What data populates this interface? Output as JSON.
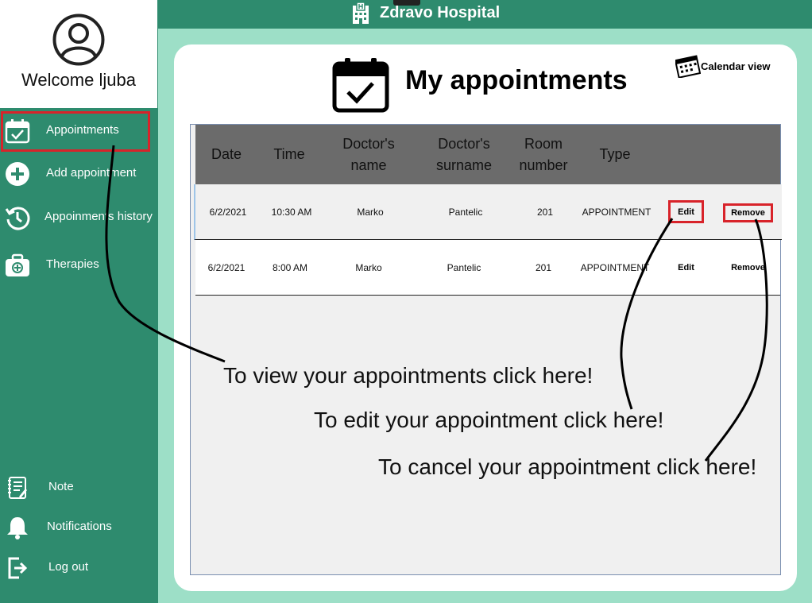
{
  "app": {
    "title": "Zdravo Hospital"
  },
  "profile": {
    "welcome": "Welcome ljuba"
  },
  "sidebar": {
    "items": [
      {
        "label": "Appointments",
        "icon": "calendar-check-icon",
        "active": true
      },
      {
        "label": "Add appointment",
        "icon": "plus-circle-icon"
      },
      {
        "label": "Appoinments history",
        "icon": "history-icon"
      },
      {
        "label": "Therapies",
        "icon": "medkit-icon"
      }
    ],
    "bottom_items": [
      {
        "label": "Note",
        "icon": "notepad-icon"
      },
      {
        "label": "Notifications",
        "icon": "bell-icon"
      },
      {
        "label": "Log out",
        "icon": "logout-icon"
      }
    ]
  },
  "page": {
    "title": "My appointments",
    "calendar_view_label": "Calendar view"
  },
  "table": {
    "headers": [
      "Date",
      "Time",
      "Doctor's name",
      "Doctor's surname",
      "Room number",
      "Type"
    ],
    "rows": [
      {
        "date": "6/2/2021",
        "time": "10:30 AM",
        "name": "Marko",
        "surname": "Pantelic",
        "room": "201",
        "type": "APPOINTMENT",
        "edit": "Edit",
        "remove": "Remove"
      },
      {
        "date": "6/2/2021",
        "time": "8:00 AM",
        "name": "Marko",
        "surname": "Pantelic",
        "room": "201",
        "type": "APPOINTMENT",
        "edit": "Edit",
        "remove": "Remove"
      }
    ]
  },
  "annotations": {
    "view": "To view your appointments click here!",
    "edit": "To edit your appointment click here!",
    "cancel": "To cancel your appointment click here!"
  },
  "colors": {
    "sidebar": "#2e8b6e",
    "content_bg": "#9ddfc7",
    "header_row": "#6b6b6b",
    "highlight": "#d8232a"
  }
}
